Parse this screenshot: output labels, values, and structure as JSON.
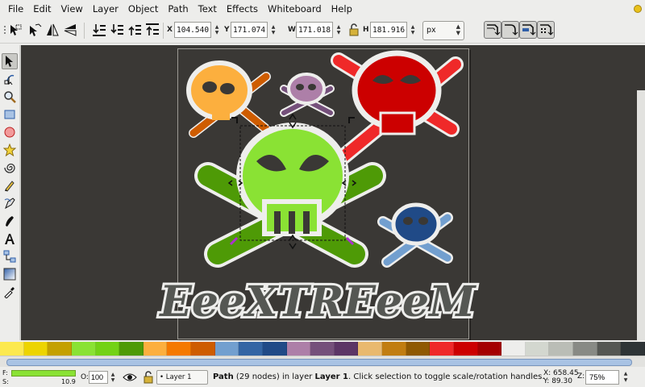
{
  "menu": [
    "File",
    "Edit",
    "View",
    "Layer",
    "Object",
    "Path",
    "Text",
    "Effects",
    "Whiteboard",
    "Help"
  ],
  "toolbar": {
    "x_label": "X",
    "x_value": "104.540",
    "y_label": "Y",
    "y_value": "171.074",
    "w_label": "W",
    "w_value": "171.018",
    "h_label": "H",
    "h_value": "181.916",
    "unit": "px",
    "left_icons": [
      "select-all-icon",
      "select-all-layers-icon",
      "flip-horizontal-icon",
      "flip-vertical-icon"
    ],
    "align_icons": [
      "lower-to-bottom-icon",
      "lower-icon",
      "raise-icon",
      "raise-to-top-icon"
    ],
    "snap_icons": [
      "scale-stroke-icon",
      "scale-rounded-corners-icon",
      "move-gradients-icon",
      "move-patterns-icon"
    ]
  },
  "tools": [
    "selector-tool-icon",
    "node-tool-icon",
    "zoom-tool-icon",
    "rectangle-tool-icon",
    "ellipse-tool-icon",
    "star-tool-icon",
    "spiral-tool-icon",
    "pencil-tool-icon",
    "pen-tool-icon",
    "calligraphy-tool-icon",
    "text-tool-icon",
    "connector-tool-icon",
    "gradient-tool-icon",
    "dropper-tool-icon"
  ],
  "artwork": {
    "logo_text": "EeeXTREeeM"
  },
  "palette": [
    "#fce94f",
    "#edd400",
    "#c4a000",
    "#8ae234",
    "#73d216",
    "#4e9a06",
    "#fcaf3e",
    "#f57900",
    "#ce5c00",
    "#729fcf",
    "#3465a4",
    "#204a87",
    "#ad7fa8",
    "#75507b",
    "#5c3566",
    "#e9b96e",
    "#c17d11",
    "#8f5902",
    "#ef2929",
    "#cc0000",
    "#a40000",
    "#eeeeec",
    "#d3d7cf",
    "#babdb6",
    "#888a85",
    "#555753",
    "#2e3436"
  ],
  "status": {
    "fill_label": "F:",
    "stroke_label": "S:",
    "stroke_width": "10.9",
    "opacity_label": "O:",
    "opacity_value": "100",
    "layer": "Layer 1",
    "msg_bold_path": "Path",
    "msg_part1": " (29 nodes) in layer ",
    "msg_bold_layer": "Layer 1",
    "msg_part2": ". Click selection to toggle scale/rotation handles.",
    "cursor_x": "X: 658.45",
    "cursor_y": "Y:   89.30",
    "zoom_label": "Z:",
    "zoom_value": "75%"
  },
  "colors": {
    "canvas_bg": "#3a3835",
    "fill": "#8ae234"
  }
}
